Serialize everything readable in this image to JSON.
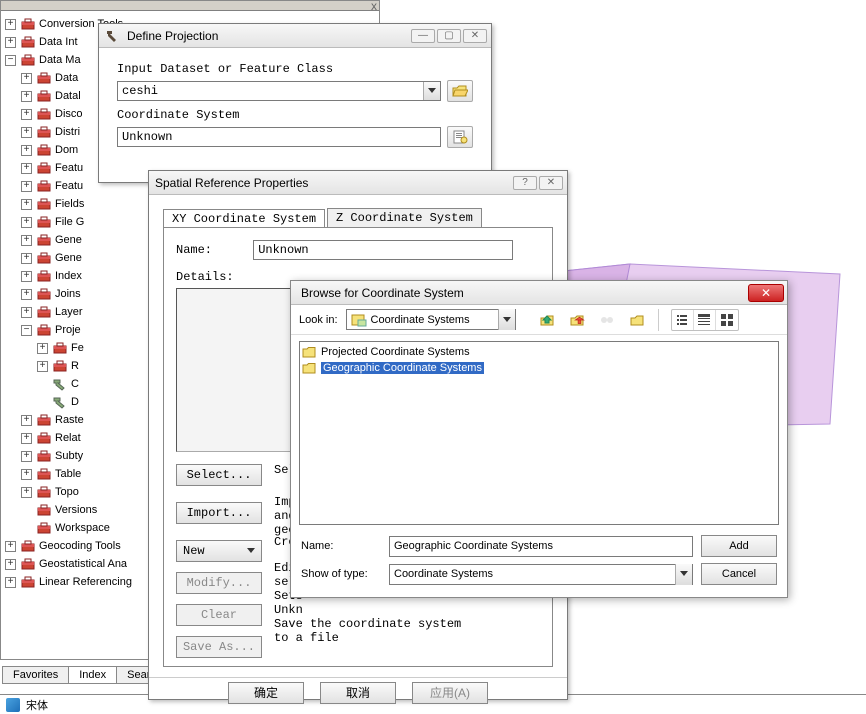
{
  "tree": {
    "top_close": "x",
    "items": [
      {
        "indent": 0,
        "exp": "+",
        "icon": "toolbox",
        "label": "Conversion Tools"
      },
      {
        "indent": 0,
        "exp": "+",
        "icon": "toolbox",
        "label": "Data Int"
      },
      {
        "indent": 0,
        "exp": "−",
        "icon": "toolbox",
        "label": "Data Ma"
      },
      {
        "indent": 1,
        "exp": "+",
        "icon": "toolbox",
        "label": "Data"
      },
      {
        "indent": 1,
        "exp": "+",
        "icon": "toolbox",
        "label": "Datal"
      },
      {
        "indent": 1,
        "exp": "+",
        "icon": "toolbox",
        "label": "Disco"
      },
      {
        "indent": 1,
        "exp": "+",
        "icon": "toolbox",
        "label": "Distri"
      },
      {
        "indent": 1,
        "exp": "+",
        "icon": "toolbox",
        "label": "Dom"
      },
      {
        "indent": 1,
        "exp": "+",
        "icon": "toolbox",
        "label": "Featu"
      },
      {
        "indent": 1,
        "exp": "+",
        "icon": "toolbox",
        "label": "Featu"
      },
      {
        "indent": 1,
        "exp": "+",
        "icon": "toolbox",
        "label": "Fields"
      },
      {
        "indent": 1,
        "exp": "+",
        "icon": "toolbox",
        "label": "File G"
      },
      {
        "indent": 1,
        "exp": "+",
        "icon": "toolbox",
        "label": "Gene"
      },
      {
        "indent": 1,
        "exp": "+",
        "icon": "toolbox",
        "label": "Gene"
      },
      {
        "indent": 1,
        "exp": "+",
        "icon": "toolbox",
        "label": "Index"
      },
      {
        "indent": 1,
        "exp": "+",
        "icon": "toolbox",
        "label": "Joins"
      },
      {
        "indent": 1,
        "exp": "+",
        "icon": "toolbox",
        "label": "Layer"
      },
      {
        "indent": 1,
        "exp": "−",
        "icon": "toolbox",
        "label": "Proje"
      },
      {
        "indent": 2,
        "exp": "+",
        "icon": "toolbox",
        "label": "Fe"
      },
      {
        "indent": 2,
        "exp": "+",
        "icon": "toolbox",
        "label": "R"
      },
      {
        "indent": 2,
        "exp": "",
        "icon": "hammer",
        "label": "C"
      },
      {
        "indent": 2,
        "exp": "",
        "icon": "hammer",
        "label": "D"
      },
      {
        "indent": 1,
        "exp": "+",
        "icon": "toolbox",
        "label": "Raste"
      },
      {
        "indent": 1,
        "exp": "+",
        "icon": "toolbox",
        "label": "Relat"
      },
      {
        "indent": 1,
        "exp": "+",
        "icon": "toolbox",
        "label": "Subty"
      },
      {
        "indent": 1,
        "exp": "+",
        "icon": "toolbox",
        "label": "Table"
      },
      {
        "indent": 1,
        "exp": "+",
        "icon": "toolbox",
        "label": "Topo"
      },
      {
        "indent": 1,
        "exp": "",
        "icon": "toolbox",
        "label": "Versions"
      },
      {
        "indent": 1,
        "exp": "",
        "icon": "toolbox",
        "label": "Workspace"
      },
      {
        "indent": 0,
        "exp": "+",
        "icon": "toolbox",
        "label": "Geocoding Tools"
      },
      {
        "indent": 0,
        "exp": "+",
        "icon": "toolbox",
        "label": "Geostatistical Ana"
      },
      {
        "indent": 0,
        "exp": "+",
        "icon": "toolbox",
        "label": "Linear Referencing"
      }
    ]
  },
  "bottom_tabs": [
    "Favorites",
    "Index",
    "Sear"
  ],
  "statusbar_text": "宋体",
  "defproj": {
    "title": "Define Projection",
    "label_input": "Input Dataset or Feature Class",
    "value_input": "ceshi",
    "label_cs": "Coordinate System",
    "value_cs": "Unknown"
  },
  "srp": {
    "title": "Spatial Reference Properties",
    "tab_xy": "XY Coordinate System",
    "tab_z": "Z Coordinate System",
    "lab_name": "Name:",
    "val_name": "Unknown",
    "lab_details": "Details:",
    "btn_select": "Select...",
    "btn_import": "Import...",
    "btn_new": "New",
    "btn_modify": "Modify...",
    "btn_clear": "Clear",
    "btn_saveas": "Save As...",
    "help_select": "Sele",
    "help_import": "Impo\nand\ngeod",
    "help_new": "Crea",
    "help_modify": "Edit\nsele",
    "help_clear": "Sets\nUnkn",
    "help_saveas": "Save the coordinate system\nto a file",
    "btn_ok": "确定",
    "btn_cancel": "取消",
    "btn_apply": "应用(A)"
  },
  "browse": {
    "title": "Browse for Coordinate System",
    "lookin_label": "Look in:",
    "lookin_value": "Coordinate Systems",
    "list": [
      {
        "label": "Projected Coordinate Systems",
        "selected": false
      },
      {
        "label": "Geographic Coordinate Systems",
        "selected": true
      }
    ],
    "name_label": "Name:",
    "name_value": "Geographic Coordinate Systems",
    "showtype_label": "Show of type:",
    "showtype_value": "Coordinate Systems",
    "btn_add": "Add",
    "btn_cancel": "Cancel"
  }
}
